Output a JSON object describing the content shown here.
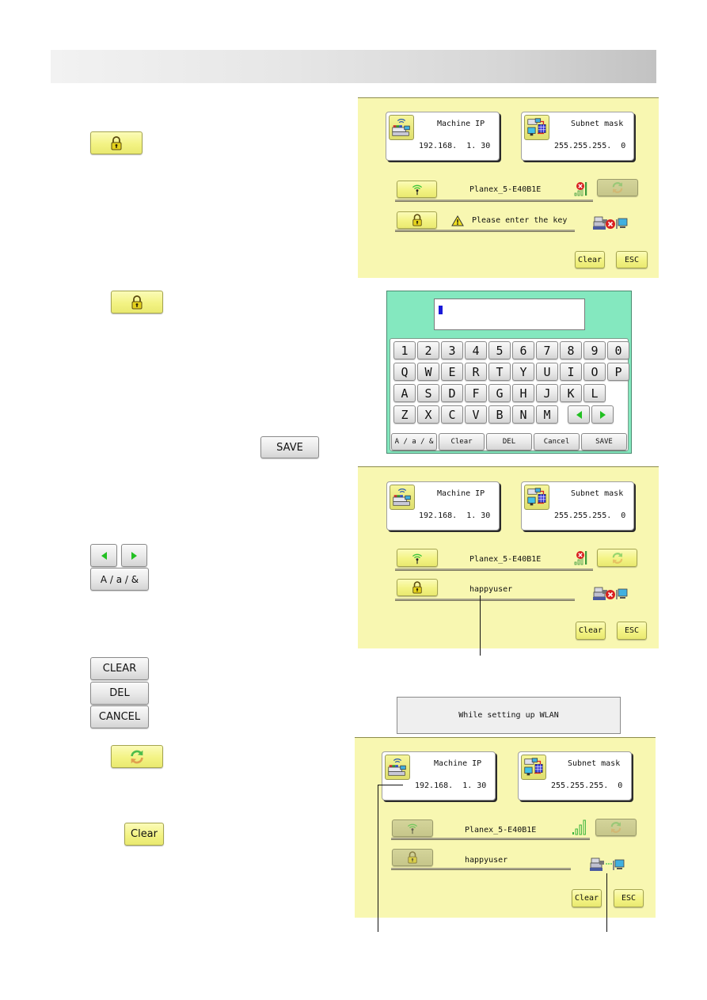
{
  "header": {
    "title": ""
  },
  "left_column": {
    "lock_button_1": {
      "icon": "padlock-icon"
    },
    "lock_button_2": {
      "icon": "padlock-icon"
    },
    "save_button": {
      "label": "SAVE"
    },
    "arrow_left": {
      "icon": "arrow-left-icon"
    },
    "arrow_right": {
      "icon": "arrow-right-icon"
    },
    "char_mode_button": {
      "label": "A / a / &"
    },
    "clear_button": {
      "label": "CLEAR"
    },
    "del_button": {
      "label": "DEL"
    },
    "cancel_button": {
      "label": "CANCEL"
    },
    "refresh_button": {
      "icon": "refresh-icon"
    },
    "clear_small_button": {
      "label": "Clear"
    }
  },
  "screen1": {
    "machine_ip": {
      "title": "Machine IP",
      "value": "192.168.  1. 30"
    },
    "subnet_mask": {
      "title": "Subnet mask",
      "value": "255.255.255.  0"
    },
    "ssid": "Planex_5-E40B1E",
    "key_status": "Please enter the key",
    "signal": "disconnected",
    "connection": "disconnected",
    "clear_label": "Clear",
    "esc_label": "ESC"
  },
  "keyboard": {
    "input_value": "",
    "rows": [
      [
        "1",
        "2",
        "3",
        "4",
        "5",
        "6",
        "7",
        "8",
        "9",
        "0"
      ],
      [
        "Q",
        "W",
        "E",
        "R",
        "T",
        "Y",
        "U",
        "I",
        "O",
        "P"
      ],
      [
        "A",
        "S",
        "D",
        "F",
        "G",
        "H",
        "J",
        "K",
        "L"
      ],
      [
        "Z",
        "X",
        "C",
        "V",
        "B",
        "N",
        "M"
      ]
    ],
    "function_keys": [
      "A / a / &",
      "Clear",
      "DEL",
      "Cancel",
      "SAVE"
    ]
  },
  "screen2": {
    "machine_ip": {
      "title": "Machine IP",
      "value": "192.168.  1. 30"
    },
    "subnet_mask": {
      "title": "Subnet mask",
      "value": "255.255.255.  0"
    },
    "ssid": "Planex_5-E40B1E",
    "key_value": "happyuser",
    "signal": "disconnected",
    "connection": "disconnected",
    "clear_label": "Clear",
    "esc_label": "ESC"
  },
  "status_message": "While setting up WLAN",
  "screen3": {
    "machine_ip": {
      "title": "Machine IP",
      "value": "192.168.  1. 30"
    },
    "subnet_mask": {
      "title": "Subnet mask",
      "value": "255.255.255.  0"
    },
    "ssid": "Planex_5-E40B1E",
    "key_value": "happyuser",
    "signal": "full",
    "connection": "connected",
    "clear_label": "Clear",
    "esc_label": "ESC"
  }
}
